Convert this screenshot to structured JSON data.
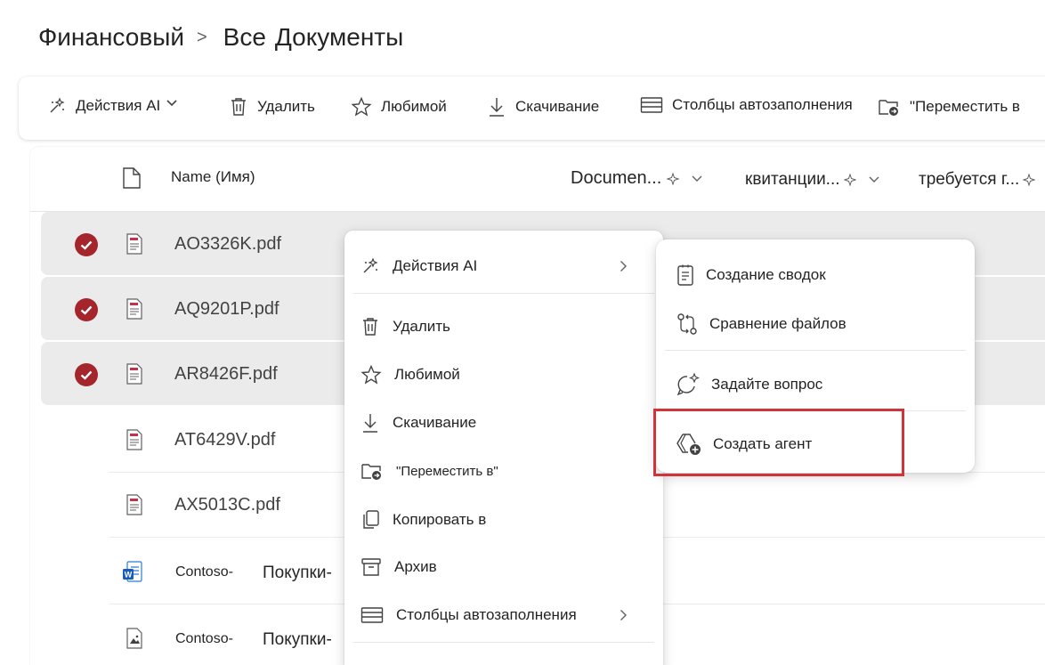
{
  "breadcrumb": {
    "root": "Финансовый",
    "separator": ">",
    "current_a": "Все",
    "current_b": "Документы"
  },
  "toolbar": {
    "ai_actions": "Действия AI",
    "delete": "Удалить",
    "favorite": "Любимой",
    "download": "Скачивание",
    "autofill_columns": "Столбцы автозаполнения",
    "move_to": "\"Переместить в"
  },
  "list": {
    "header": {
      "name": "Name (Имя)",
      "col1": "Documen...",
      "col2": "квитанции...",
      "col3": "требуется г..."
    },
    "rows": [
      {
        "name": "AO3326K.pdf",
        "selected": true,
        "icon": "pdf-icon"
      },
      {
        "name": "AQ9201P.pdf",
        "selected": true,
        "icon": "pdf-icon"
      },
      {
        "name": "AR8426F.pdf",
        "selected": true,
        "icon": "pdf-icon"
      },
      {
        "name": "AT6429V.pdf",
        "selected": false,
        "icon": "pdf-icon"
      },
      {
        "name": "AX5013C.pdf",
        "selected": false,
        "icon": "pdf-icon"
      },
      {
        "name_a": "Contoso-",
        "name_b": "Покупки-",
        "selected": false,
        "icon": "word-icon"
      },
      {
        "name_a": "Contoso-",
        "name_b": "Покупки-",
        "selected": false,
        "icon": "image-icon"
      }
    ]
  },
  "context_menu": {
    "items": [
      {
        "label": "Действия AI",
        "has_submenu": true
      },
      {
        "label": "Удалить"
      },
      {
        "label": "Любимой"
      },
      {
        "label": "Скачивание"
      },
      {
        "label": "\"Переместить в\""
      },
      {
        "label": "Копировать в"
      },
      {
        "label": "Архив"
      },
      {
        "label": "Столбцы автозаполнения",
        "has_submenu": true
      }
    ]
  },
  "submenu": {
    "items": [
      {
        "label": "Создание сводок"
      },
      {
        "label": "Сравнение файлов"
      },
      {
        "label": "Задайте вопрос"
      },
      {
        "label": "Создать агент",
        "highlighted": true
      }
    ]
  },
  "colors": {
    "accent": "#a4262c",
    "highlight": "#d13438",
    "selected_row": "#ebebeb"
  }
}
